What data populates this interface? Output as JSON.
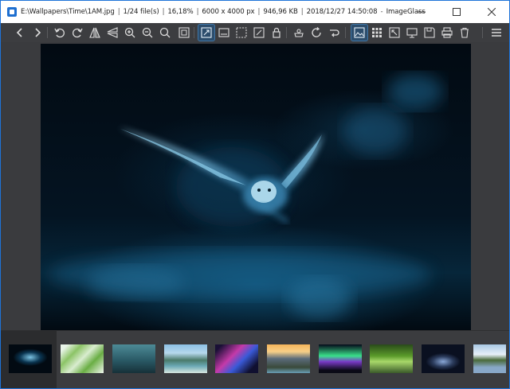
{
  "titlebar": {
    "path": "E:\\Wallpapers\\Time\\1AM.jpg",
    "file_index": "1/24 file(s)",
    "zoom": "16,18%",
    "dimensions": "6000 x 4000 px",
    "file_size": "946,96 KB",
    "modified": "2018/12/27 14:50:08",
    "app_name": "ImageGlass"
  },
  "toolbar": {
    "buttons": [
      {
        "name": "previous-image-icon"
      },
      {
        "name": "next-image-icon"
      },
      {
        "name": "rotate-left-icon"
      },
      {
        "name": "rotate-right-icon"
      },
      {
        "name": "flip-horizontal-icon"
      },
      {
        "name": "flip-vertical-icon"
      },
      {
        "name": "zoom-in-icon"
      },
      {
        "name": "zoom-out-icon"
      },
      {
        "name": "zoom-to-fit-icon"
      },
      {
        "name": "actual-size-icon"
      },
      {
        "name": "auto-zoom-icon",
        "active": true
      },
      {
        "name": "scale-to-width-icon"
      },
      {
        "name": "scale-to-height-icon"
      },
      {
        "name": "scale-to-fill-icon"
      },
      {
        "name": "lock-zoom-icon"
      },
      {
        "name": "print-icon"
      },
      {
        "name": "refresh-icon"
      },
      {
        "name": "go-to-image-icon"
      },
      {
        "name": "thumbnail-bar-icon",
        "active": true
      },
      {
        "name": "checkerboard-icon"
      },
      {
        "name": "fullscreen-icon"
      },
      {
        "name": "slideshow-icon"
      },
      {
        "name": "save-icon"
      },
      {
        "name": "print-image-icon"
      },
      {
        "name": "delete-icon"
      },
      {
        "name": "menu-icon"
      }
    ]
  },
  "thumbnails": [
    {
      "name": "thumb-owl",
      "selected": true
    },
    {
      "name": "thumb-leaves"
    },
    {
      "name": "thumb-misty-tree"
    },
    {
      "name": "thumb-lake-valley"
    },
    {
      "name": "thumb-neon-city"
    },
    {
      "name": "thumb-mountain-sunset"
    },
    {
      "name": "thumb-aurora"
    },
    {
      "name": "thumb-forest-stream"
    },
    {
      "name": "thumb-night-forest"
    },
    {
      "name": "thumb-reflection-lake"
    }
  ],
  "colors": {
    "accent": "#1e73d8",
    "toolbar_bg": "#3c3d40",
    "active_button": "#2c4d6c"
  }
}
